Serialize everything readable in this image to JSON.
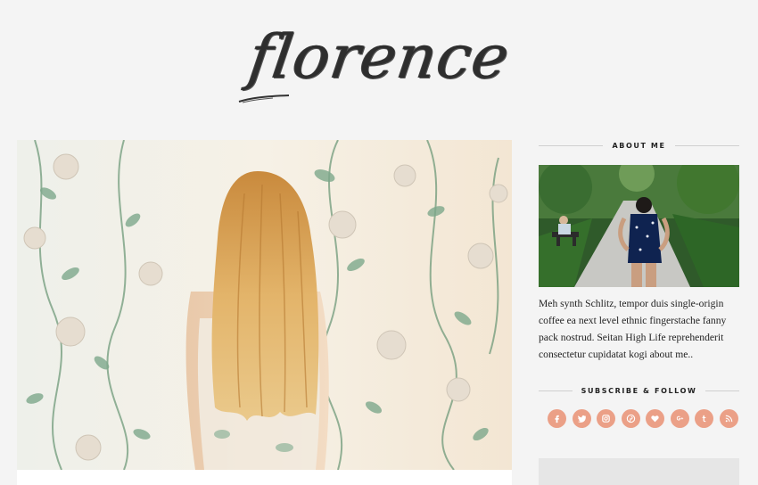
{
  "site": {
    "logo_text": "florence"
  },
  "sidebar": {
    "about_title": "ABOUT ME",
    "about_text": "Meh synth Schlitz, tempor duis single-origin coffee ea next level ethnic fingerstache fanny pack nostrud. Seitan High Life reprehenderit consectetur cupidatat kogi about me..",
    "subscribe_title": "SUBSCRIBE & FOLLOW",
    "social_icons": [
      "facebook-icon",
      "twitter-icon",
      "instagram-icon",
      "pinterest-icon",
      "bloglovin-icon",
      "google-plus-icon",
      "tumblr-icon",
      "rss-icon"
    ],
    "accent_color": "#eba087"
  }
}
